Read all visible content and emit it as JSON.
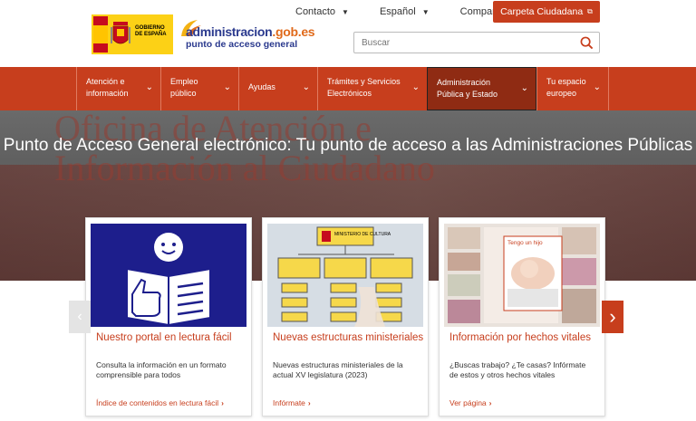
{
  "header": {
    "gov_logo_text": "GOBIERNO DE ESPAÑA",
    "brand_title_a": "administracion",
    "brand_title_b": ".gob.es",
    "brand_subtitle": "punto de acceso general",
    "top_links": [
      "Contacto",
      "Español",
      "Compartir"
    ],
    "carpeta_label": "Carpeta Ciudadana",
    "search_placeholder": "Buscar",
    "colors": {
      "accent": "#c73e1d",
      "brand_blue": "#2b3a8e",
      "brand_orange": "#e06a1b"
    }
  },
  "nav": {
    "items": [
      {
        "label": "Atención e información"
      },
      {
        "label": "Empleo público"
      },
      {
        "label": "Ayudas"
      },
      {
        "label": "Trámites y Servicios Electrónicos"
      },
      {
        "label": "Administración Pública y Estado"
      },
      {
        "label": "Tu espacio europeo"
      }
    ]
  },
  "hero": {
    "background_text": "Oficina de Atención e Información al Ciudadano",
    "title": "Punto de Acceso General electrónico: Tu punto de acceso a las Administraciones Públicas"
  },
  "cards": [
    {
      "title": "Nuestro portal en lectura fácil",
      "desc": "Consulta la información en un formato comprensible para todos",
      "link": "Índice de contenidos en lectura fácil"
    },
    {
      "title": "Nuevas estructuras ministeriales",
      "desc": "Nuevas estructuras ministeriales de la actual XV legislatura (2023)",
      "link": "Infórmate",
      "image_label": "MINISTERIO DE CULTURA"
    },
    {
      "title": "Información por hechos vitales",
      "desc": "¿Buscas trabajo? ¿Te casas? Infórmate de estos y otros hechos vitales",
      "link": "Ver página",
      "image_label": "Tengo un hijo"
    }
  ]
}
